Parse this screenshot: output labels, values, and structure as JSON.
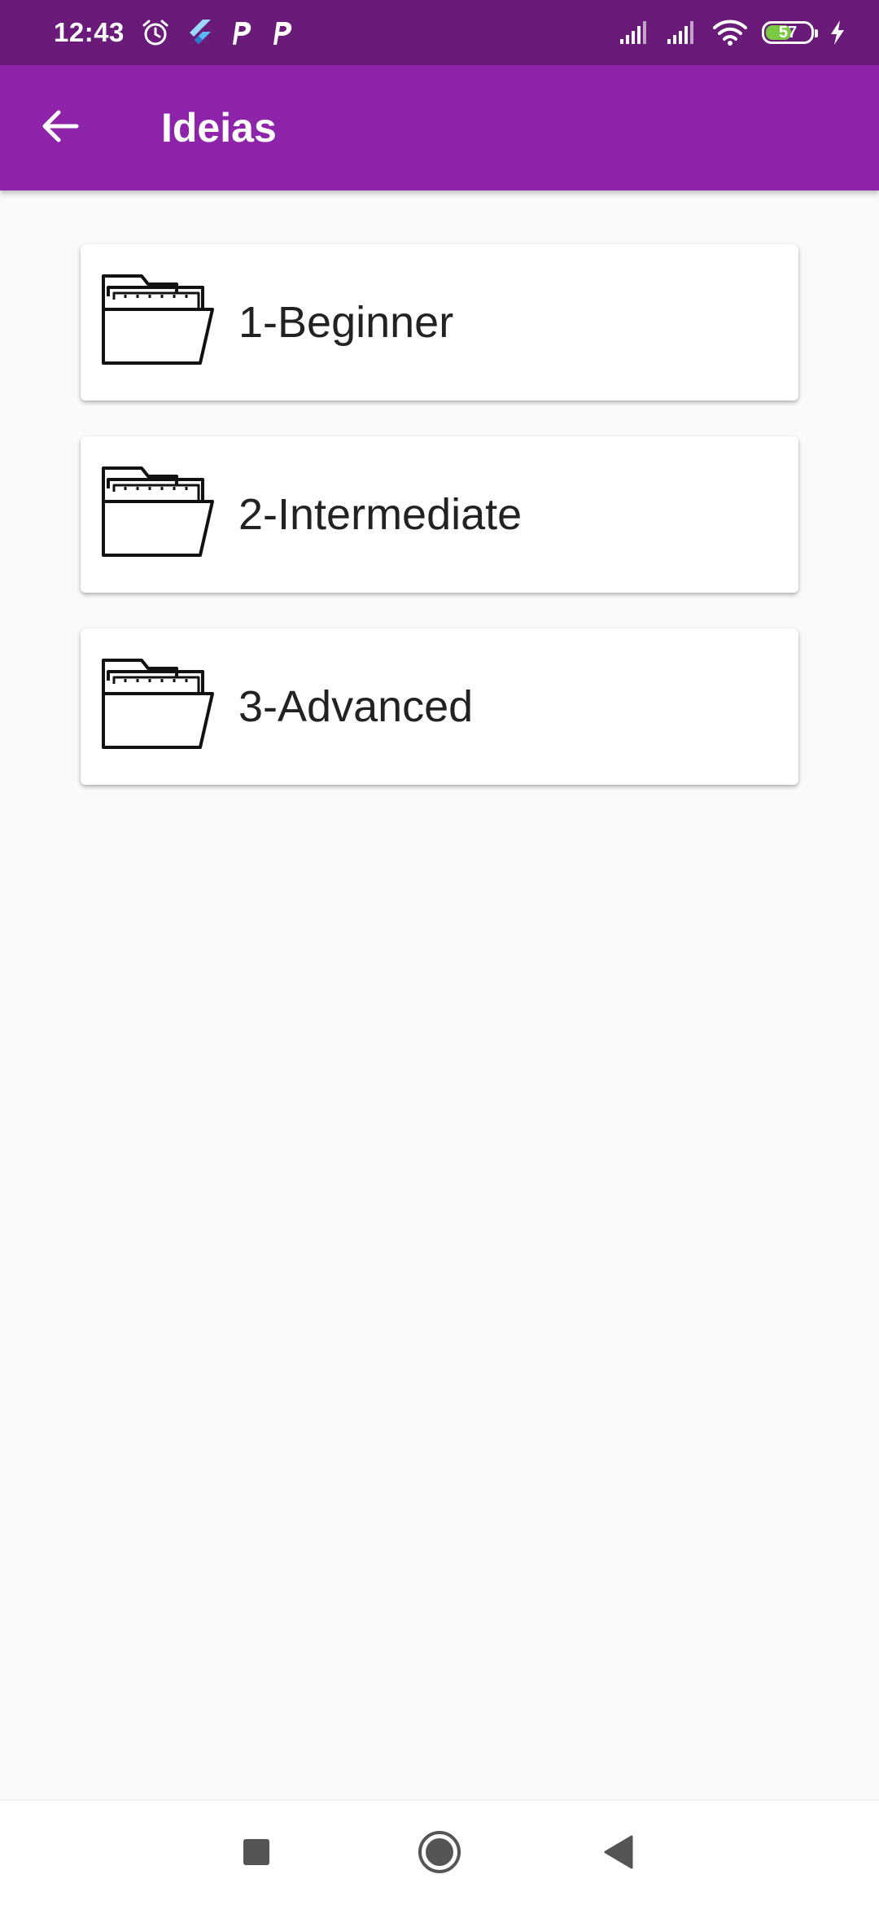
{
  "status_bar": {
    "time": "12:43",
    "battery_level": 57,
    "battery_label": "57",
    "left_icons": [
      "alarm-icon",
      "flutter-icon",
      "p-app-icon",
      "p-app-icon"
    ],
    "right_icons": [
      "signal-icon",
      "signal-icon",
      "wifi-icon",
      "battery-icon",
      "charging-icon"
    ]
  },
  "app_bar": {
    "title": "Ideias",
    "back_icon": "arrow-back-icon"
  },
  "folders": [
    {
      "label": "1-Beginner",
      "icon": "folder-open-icon"
    },
    {
      "label": "2-Intermediate",
      "icon": "folder-open-icon"
    },
    {
      "label": "3-Advanced",
      "icon": "folder-open-icon"
    }
  ],
  "nav_bar": {
    "buttons": [
      "recents-square-icon",
      "home-circle-icon",
      "back-triangle-icon"
    ]
  },
  "colors": {
    "status_bar": "#6a1b7a",
    "app_bar": "#8e24aa",
    "background": "#fafafa",
    "card": "#ffffff",
    "battery_fill": "#7ac943"
  }
}
